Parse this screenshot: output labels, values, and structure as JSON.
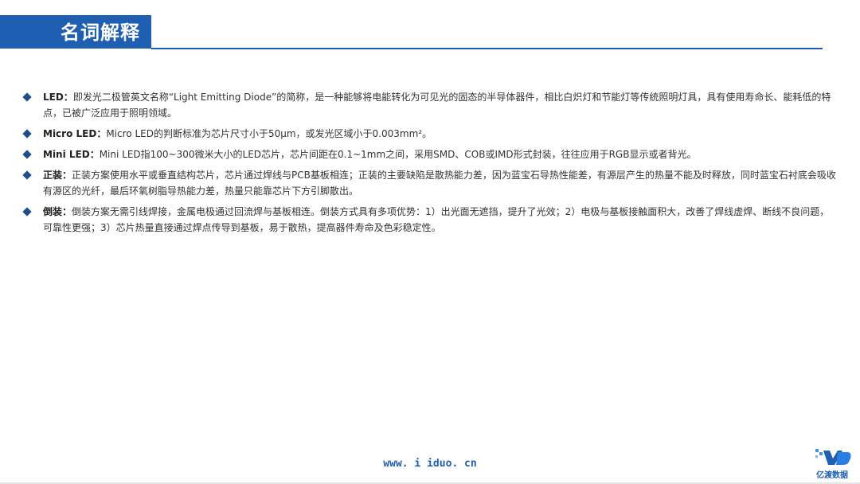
{
  "header": {
    "title": "名词解释"
  },
  "terms": [
    {
      "name": "LED：",
      "text": "即发光二极管英文名称“Light Emitting Diode”的简称，是一种能够将电能转化为可见光的固态的半导体器件，相比白炽灯和节能灯等传统照明灯具，具有使用寿命长、能耗低的特点，已被广泛应用于照明领域。"
    },
    {
      "name": "Micro LED：",
      "text": "Micro LED的判断标准为芯片尺寸小于50μm，或发光区域小于0.003mm²。"
    },
    {
      "name": "Mini LED：",
      "text": "Mini LED指100~300微米大小的LED芯片，芯片间距在0.1~1mm之间，采用SMD、COB或IMD形式封装，往往应用于RGB显示或者背光。"
    },
    {
      "name": "正装：",
      "text": "正装方案使用水平或垂直结构芯片，芯片通过焊线与PCB基板相连；正装的主要缺陷是散热能力差，因为蓝宝石导热性能差，有源层产生的热量不能及时释放，同时蓝宝石衬底会吸收有源区的光纤，最后环氧树脂导热能力差，热量只能靠芯片下方引脚散出。"
    },
    {
      "name": "倒装：",
      "text": "倒装方案无需引线焊接，金属电极通过回流焊与基板相连。倒装方式具有多项优势：1）出光面无遮挡，提升了光效；2）电极与基板接触面积大，改善了焊线虚焊、断线不良问题，可靠性更强；3）芯片热量直接通过焊点传导到基板，易于散热，提高器件寿命及色彩稳定性。"
    }
  ],
  "footer": {
    "url": "www. i iduo. cn",
    "logo_text": "亿渡数据"
  },
  "colors": {
    "brand_blue": "#1f5fb2",
    "bullet": "#1f4e8c"
  }
}
